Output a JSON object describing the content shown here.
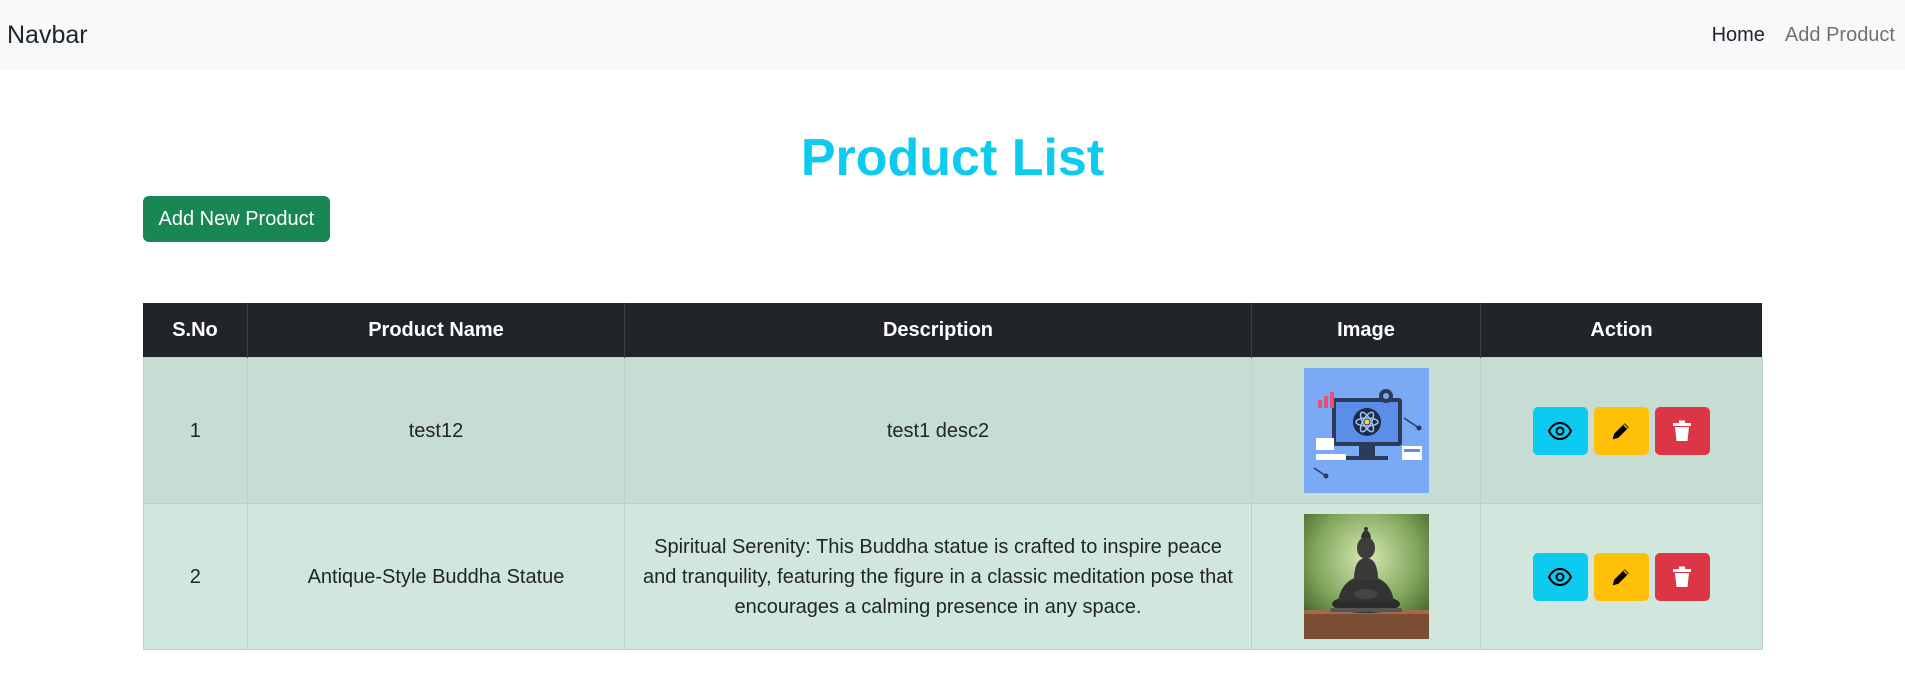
{
  "navbar": {
    "brand": "Navbar",
    "links": [
      {
        "label": "Home",
        "active": true
      },
      {
        "label": "Add Product",
        "active": false
      }
    ]
  },
  "page": {
    "title": "Product List",
    "add_button": "Add New Product"
  },
  "table": {
    "headers": [
      "S.No",
      "Product Name",
      "Description",
      "Image",
      "Action"
    ],
    "rows": [
      {
        "sno": "1",
        "name": "test12",
        "description": "test1 desc2",
        "image_icon": "tech-illustration-image",
        "actions": [
          "view-icon",
          "edit-icon",
          "delete-icon"
        ]
      },
      {
        "sno": "2",
        "name": "Antique-Style Buddha Statue",
        "description": "Spiritual Serenity: This Buddha statue is crafted to inspire peace and tranquility, featuring the figure in a classic meditation pose that encourages a calming presence in any space.",
        "image_icon": "buddha-statue-image",
        "actions": [
          "view-icon",
          "edit-icon",
          "delete-icon"
        ]
      }
    ]
  },
  "colors": {
    "title": "#0dcaf0",
    "add_button": "#198754",
    "view": "#0dcaf0",
    "edit": "#ffc107",
    "delete": "#dc3545"
  }
}
